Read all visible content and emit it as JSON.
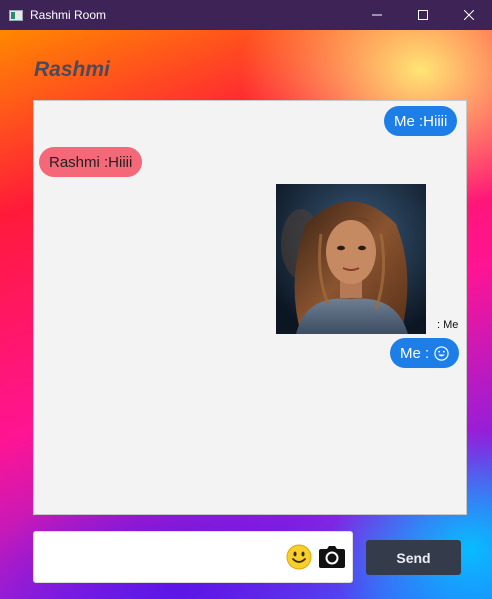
{
  "window": {
    "title": "Rashmi Room",
    "controls": [
      "minimize-icon",
      "maximize-icon",
      "close-icon"
    ]
  },
  "chat": {
    "contact_name": "Rashmi",
    "messages": [
      {
        "from": "me",
        "text": "Me :Hiiii"
      },
      {
        "from": "other",
        "text": "Rashmi :Hiiii"
      },
      {
        "from": "me",
        "type": "image",
        "caption": ": Me"
      },
      {
        "from": "me",
        "text": "Me :",
        "emoji": "smiley-emoji-icon"
      }
    ]
  },
  "composer": {
    "input_value": "",
    "input_placeholder": "",
    "emoji_icon": "smiley-icon",
    "camera_icon": "camera-icon",
    "send_label": "Send"
  },
  "colors": {
    "me_bubble": "#1e7ee8",
    "other_bubble": "#f46878",
    "send_button": "#343b4a",
    "title_bar": "#3d2356"
  }
}
